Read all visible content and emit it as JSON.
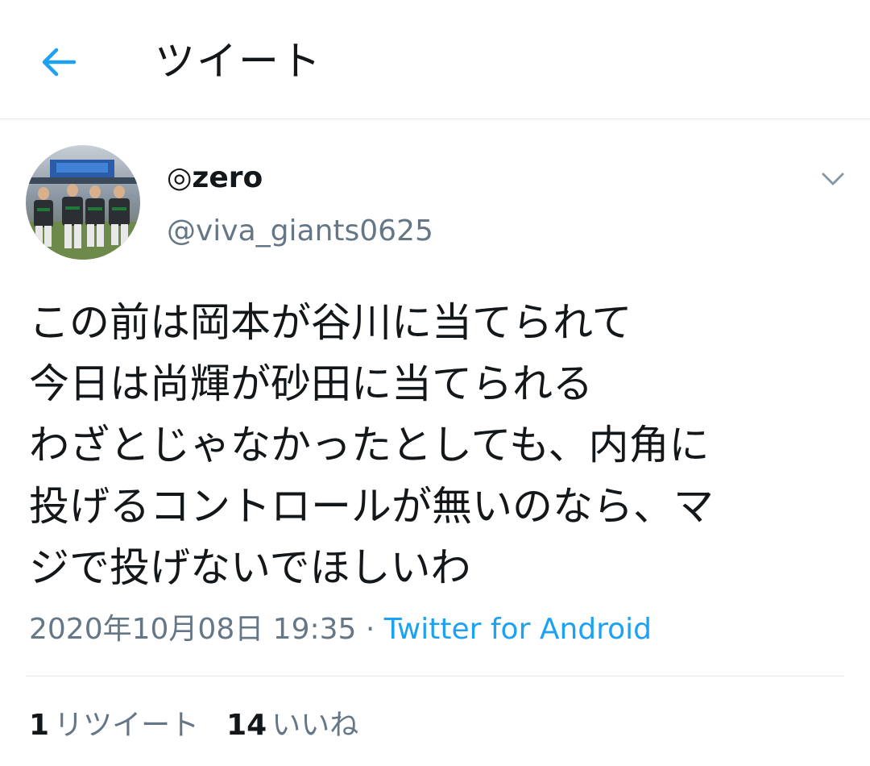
{
  "header": {
    "back_icon": "arrow-left-icon",
    "title": "ツイート",
    "accent_color": "#1da1f2"
  },
  "tweet": {
    "avatar_icon": "profile-photo-baseball-players",
    "display_name": "◎zero",
    "handle": "@viva_giants0625",
    "menu_icon": "chevron-down-icon",
    "text_lines": [
      "この前は岡本が谷川に当てられて",
      "今日は尚輝が砂田に当てられる",
      "わざとじゃなかったとしても、内角に",
      "投げるコントロールが無いのなら、マ",
      "ジで投げないでほしいわ"
    ],
    "timestamp": "2020年10月08日 19:35",
    "separator": " · ",
    "source": "Twitter for Android"
  },
  "stats": {
    "retweets_count": "1",
    "retweets_label": "リツイート",
    "likes_count": "14",
    "likes_label": "いいね"
  },
  "colors": {
    "text_primary": "#14171a",
    "text_secondary": "#657786",
    "border": "#e1e8ed"
  }
}
